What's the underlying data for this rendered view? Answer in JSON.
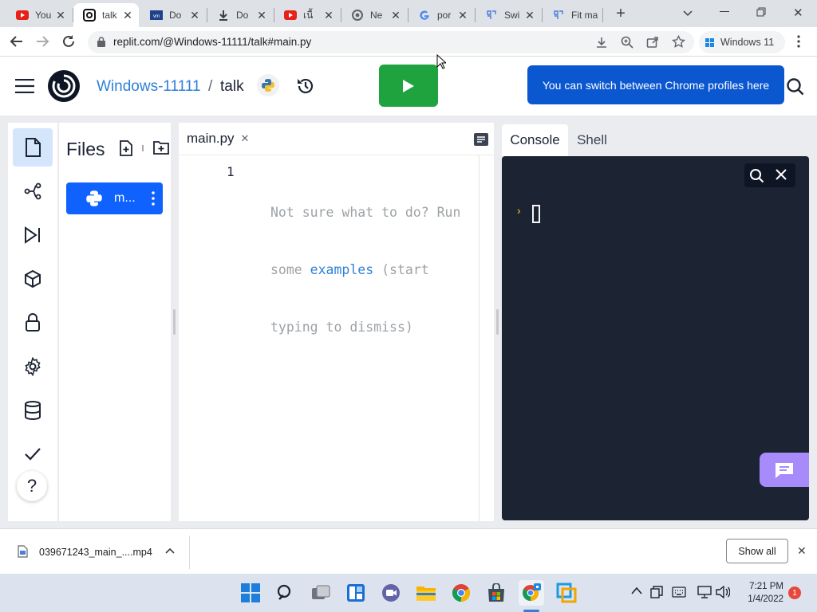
{
  "browser": {
    "tabs": [
      {
        "title": "You",
        "icon": "youtube-icon"
      },
      {
        "title": "talk",
        "icon": "replit-icon",
        "active": true
      },
      {
        "title": "Do",
        "icon": "vmware-icon"
      },
      {
        "title": "Do",
        "icon": "download-icon"
      },
      {
        "title": "เนื้",
        "icon": "youtube-icon"
      },
      {
        "title": "Ne",
        "icon": "chrome-icon"
      },
      {
        "title": "por",
        "icon": "google-icon"
      },
      {
        "title": "Swi",
        "icon": "azure-icon"
      },
      {
        "title": "Fit man",
        "icon": "azure-icon"
      }
    ],
    "url": "replit.com/@Windows-11111/talk#main.py",
    "profile_label": "Windows 11"
  },
  "repl": {
    "owner": "Windows-11111",
    "separator": "/",
    "name": "talk",
    "tooltip": "You can switch between Chrome profiles here"
  },
  "files": {
    "title": "Files",
    "file_name": "m..."
  },
  "editor": {
    "tab_name": "main.py",
    "line_number": "1",
    "hint_1": "Not sure what to do? Run",
    "hint_2_pre": "some ",
    "hint_2_link": "examples",
    "hint_2_post": " (start",
    "hint_3": "typing to dismiss)"
  },
  "console": {
    "tabs": [
      "Console",
      "Shell"
    ],
    "prompt": "›"
  },
  "downloads": {
    "file": "039671243_main_....mp4",
    "show_all": "Show all"
  },
  "taskbar": {
    "time": "7:21 PM",
    "date": "1/4/2022",
    "notification_count": "1"
  },
  "colors": {
    "accent": "#0f62fe",
    "run_green": "#1ea33e",
    "console_bg": "#1c2333",
    "tooltip_blue": "#0b57d0"
  }
}
